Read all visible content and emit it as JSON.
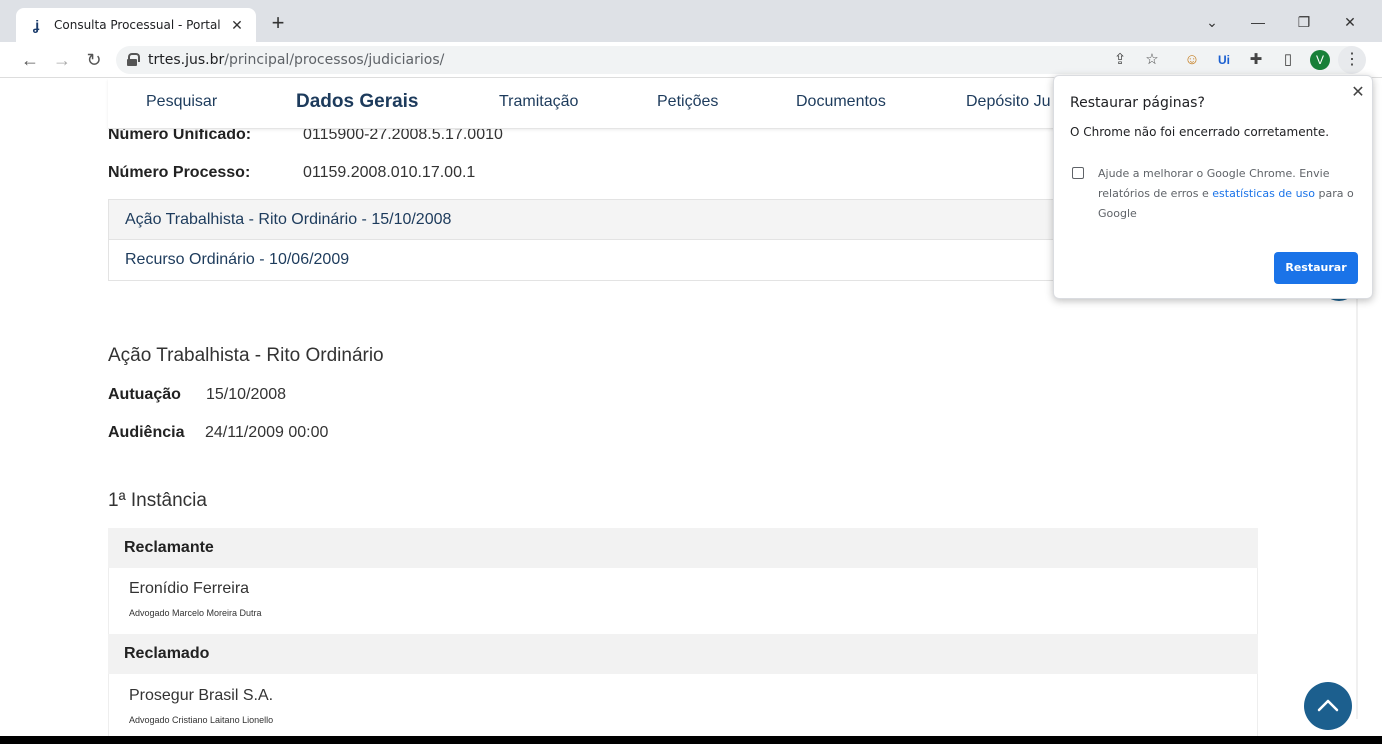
{
  "browser": {
    "tab_title": "Consulta Processual - Portal do T",
    "url_host": "trtes.jus.br",
    "url_path": "/principal/processos/judiciarios/",
    "profile_initial": "V"
  },
  "nav": {
    "items": [
      "Pesquisar",
      "Dados Gerais",
      "Tramitação",
      "Petições",
      "Documentos",
      "Depósito Ju"
    ]
  },
  "process": {
    "unified_label": "Número Unificado:",
    "unified_value": "0115900-27.2008.5.17.0010",
    "number_label": "Número Processo:",
    "number_value": "01159.2008.010.17.00.1"
  },
  "phases": [
    "Ação Trabalhista - Rito Ordinário - 15/10/2008",
    "Recurso Ordinário - 10/06/2009"
  ],
  "detail": {
    "title": "Ação Trabalhista - Rito Ordinário",
    "autuacao_label": "Autuação",
    "autuacao_value": "15/10/2008",
    "audiencia_label": "Audiência",
    "audiencia_value": "24/11/2009 00:00"
  },
  "instance": {
    "title": "1ª Instância",
    "reclamante_header": "Reclamante",
    "reclamante_name": "Eronídio Ferreira",
    "reclamante_lawyer": "Advogado Marcelo Moreira Dutra",
    "reclamado_header": "Reclamado",
    "reclamado_name": "Prosegur Brasil S.A.",
    "reclamado_lawyer": "Advogado Cristiano Laitano Lionello"
  },
  "popup": {
    "title": "Restaurar páginas?",
    "message": "O Chrome não foi encerrado corretamente.",
    "help_prefix": "Ajude a melhorar o Google Chrome. Envie relatórios de erros e",
    "help_link": "estatísticas de uso",
    "help_suffix": "para o Google",
    "button": "Restaurar"
  },
  "colors": {
    "nav_text": "#1d3b5c",
    "fab": "#1c5f8e",
    "chrome_button": "#1a73e8"
  }
}
